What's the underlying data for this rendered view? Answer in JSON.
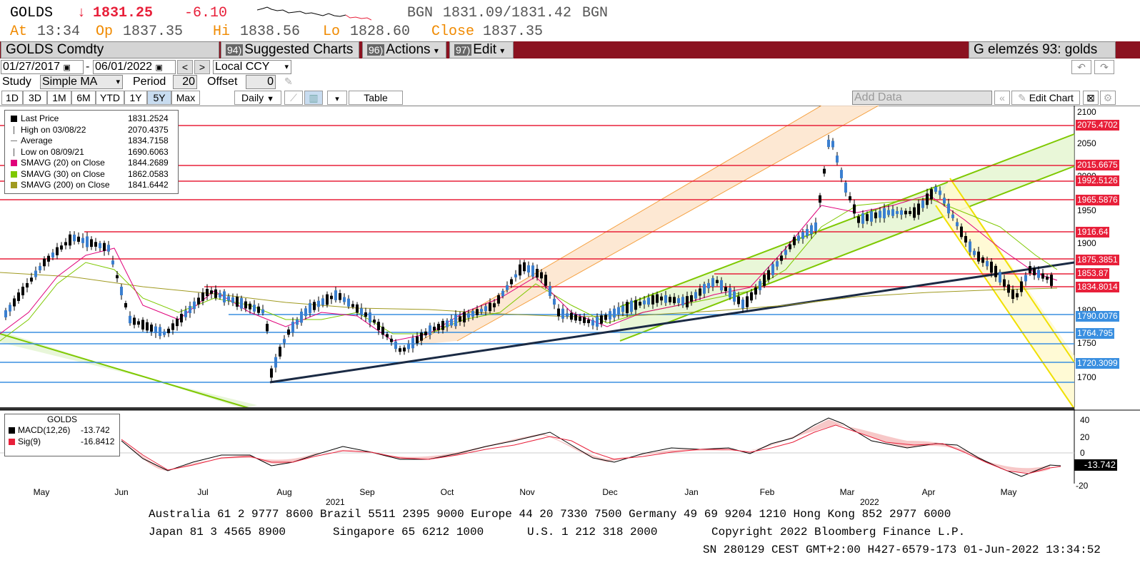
{
  "header": {
    "ticker": "GOLDS",
    "arrow": "↓",
    "last": "1831.25",
    "change": "-6.10",
    "bgn_label": "BGN",
    "bid_ask": "1831.09/1831.42",
    "bgn_label2": "BGN",
    "at_label": "At",
    "at_time": "13:34",
    "op_label": "Op",
    "op_value": "1837.35",
    "hi_label": "Hi",
    "hi_value": "1838.56",
    "lo_label": "Lo",
    "lo_value": "1828.60",
    "close_label": "Close",
    "close_value": "1837.35"
  },
  "menubar": {
    "security": "GOLDS Comdty",
    "suggested_num": "94)",
    "suggested_label": "Suggested Charts",
    "actions_num": "96)",
    "actions_label": "Actions",
    "edit_num": "97)",
    "edit_label": "Edit",
    "right_title": "G elemzés 93: golds"
  },
  "toolbar1": {
    "start_date": "01/27/2017",
    "dash": "-",
    "end_date": "06/01/2022",
    "prev": "<",
    "next": ">",
    "currency": "Local CCY"
  },
  "toolbar2": {
    "study_label": "Study",
    "study_value": "Simple MA",
    "period_label": "Period",
    "period_value": "20",
    "offset_label": "Offset",
    "offset_value": "0"
  },
  "toolbar3": {
    "ranges": [
      "1D",
      "3D",
      "1M",
      "6M",
      "YTD",
      "1Y",
      "5Y",
      "Max"
    ],
    "active_range": "5Y",
    "frequency": "Daily",
    "table_label": "Table",
    "add_data_placeholder": "Add Data",
    "edit_chart": "Edit Chart"
  },
  "legend": {
    "rows": [
      {
        "name": "Last Price",
        "value": "1831.2524",
        "color": "#000000",
        "marker": "square"
      },
      {
        "name": "High on 03/08/22",
        "value": "2070.4375",
        "color": "#555555",
        "marker": "high"
      },
      {
        "name": "Average",
        "value": "1834.7158",
        "color": "#777777",
        "marker": "avg"
      },
      {
        "name": "Low on 08/09/21",
        "value": "1690.6063",
        "color": "#555555",
        "marker": "low"
      },
      {
        "name": "SMAVG (20)  on Close",
        "value": "1844.2689",
        "color": "#e0007a",
        "marker": "square"
      },
      {
        "name": "SMAVG (30)  on Close",
        "value": "1862.0583",
        "color": "#7ec800",
        "marker": "square"
      },
      {
        "name": "SMAVG (200)  on Close",
        "value": "1841.6442",
        "color": "#a09a20",
        "marker": "square"
      }
    ]
  },
  "price_axis": {
    "ticks": [
      "2100",
      "2050",
      "2000",
      "1950",
      "1900",
      "1800",
      "1750",
      "1700"
    ],
    "tags": [
      {
        "value": "2075.4702",
        "color": "#e8203a"
      },
      {
        "value": "2015.6675",
        "color": "#e8203a"
      },
      {
        "value": "1992.5126",
        "color": "#e8203a"
      },
      {
        "value": "1965.5876",
        "color": "#e8203a"
      },
      {
        "value": "1916.64",
        "color": "#e8203a"
      },
      {
        "value": "1875.3851",
        "color": "#e8203a"
      },
      {
        "value": "1853.87",
        "color": "#e8203a"
      },
      {
        "value": "1834.8014",
        "color": "#e8203a"
      },
      {
        "value": "1790.0076",
        "color": "#3a8fe0"
      },
      {
        "value": "1764.795",
        "color": "#3a8fe0"
      },
      {
        "value": "1720.3099",
        "color": "#3a8fe0"
      }
    ]
  },
  "macd": {
    "title": "GOLDS",
    "macd_label": "MACD(12,26)",
    "macd_value": "-13.742",
    "sig_label": "Sig(9)",
    "sig_value": "-16.8412",
    "ticks": [
      "40",
      "20",
      "0",
      "-20"
    ],
    "tag": "-13.742"
  },
  "time_axis": {
    "months": [
      "May",
      "Jun",
      "Jul",
      "Aug",
      "Sep",
      "Oct",
      "Nov",
      "Dec",
      "Jan",
      "Feb",
      "Mar",
      "Apr",
      "May"
    ],
    "year_2021": "2021",
    "year_2022": "2022"
  },
  "footer": {
    "line1": "Australia 61 2 9777 8600 Brazil 5511 2395 9000 Europe 44 20 7330 7500 Germany 49 69 9204 1210 Hong Kong 852 2977 6000",
    "line2_a": "Japan 81 3 4565 8900",
    "line2_b": "Singapore 65 6212 1000",
    "line2_c": "U.S. 1 212 318 2000",
    "line2_d": "Copyright 2022 Bloomberg Finance L.P.",
    "line3": "SN 280129 CEST GMT+2:00 H427-6579-173 01-Jun-2022 13:34:52"
  },
  "colors": {
    "menubar": "#8b1220",
    "red_line": "#e8203a",
    "blue_line": "#3a8fe0",
    "green_channel": "#7ec800",
    "orange_channel": "#f5a040",
    "yellow_channel": "#f0e000",
    "trendline": "#1a2a44"
  }
}
